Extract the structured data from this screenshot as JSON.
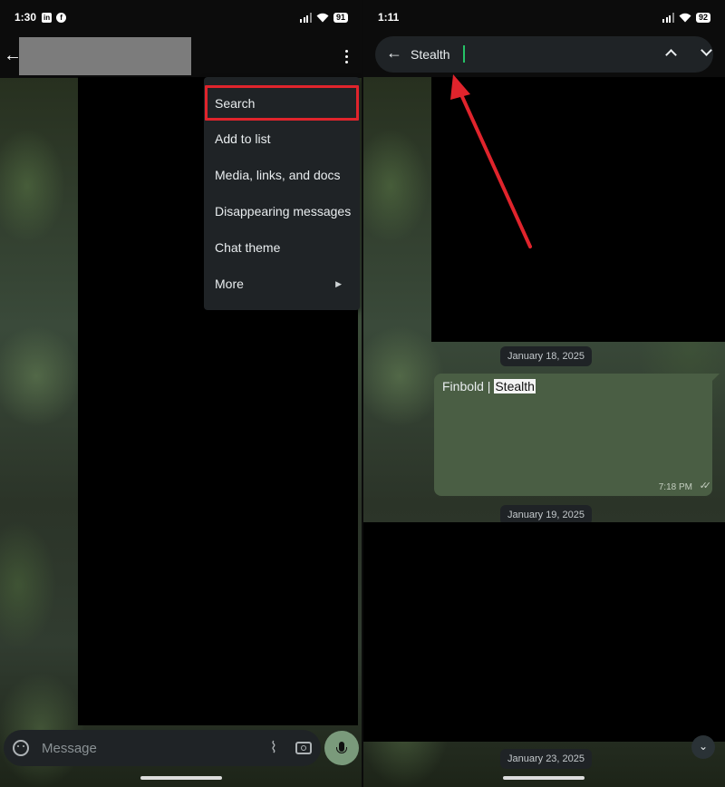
{
  "left_screen": {
    "status_bar": {
      "time": "1:30",
      "app_icons": [
        "linkedin-icon",
        "facebook-icon"
      ],
      "battery": "91"
    },
    "menu": {
      "items": [
        {
          "label": "Search",
          "highlighted": true
        },
        {
          "label": "Add to list"
        },
        {
          "label": "Media, links, and docs"
        },
        {
          "label": "Disappearing messages"
        },
        {
          "label": "Chat theme"
        },
        {
          "label": "More",
          "has_submenu": true
        }
      ]
    },
    "composer": {
      "placeholder": "Message"
    },
    "colors": {
      "highlight_border": "#e0242c",
      "mic_button": "#7a9a7b",
      "menu_bg": "#1f2326"
    }
  },
  "right_screen": {
    "status_bar": {
      "time": "1:11",
      "battery": "92"
    },
    "search": {
      "query": "Stealth"
    },
    "dates": [
      "January 18, 2025",
      "January 19, 2025",
      "January 23, 2025"
    ],
    "message": {
      "prefix": "Finbold | ",
      "match": "Stealth",
      "time": "7:18 PM",
      "read_ticks": "✓✓"
    },
    "colors": {
      "bubble": "#4a5e44",
      "caret": "#25c266",
      "arrow": "#e0242c"
    }
  }
}
